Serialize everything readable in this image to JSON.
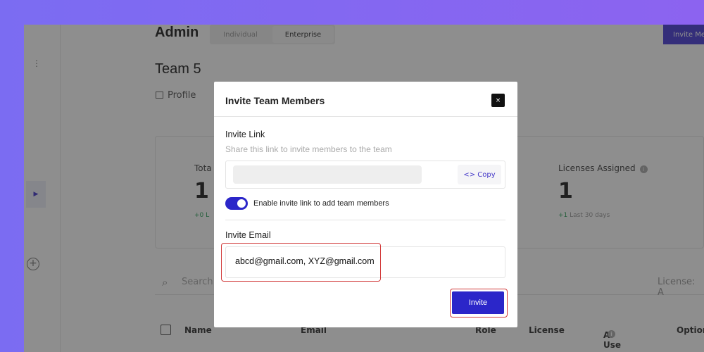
{
  "background_page": {
    "admin_title": "Admin",
    "segments": [
      "Individual",
      "Enterprise"
    ],
    "top_button": "Invite Me",
    "team_name": "Team 5",
    "tab_profile": "Profile",
    "stats": [
      {
        "label": "Tota",
        "value": "1",
        "delta": "+0 L"
      },
      {
        "label": "Licenses Assigned",
        "value": "1",
        "delta_value": "+1",
        "delta_text": "Last 30 days"
      }
    ],
    "search_placeholder": "Search",
    "license_filter": "License: A",
    "table_headers": [
      "Name",
      "Email",
      "Role",
      "License",
      "AI Use",
      "Option"
    ]
  },
  "modal": {
    "title": "Invite Team Members",
    "close_label": "×",
    "invite_link": {
      "label": "Invite Link",
      "subtitle": "Share this link to invite members to the team",
      "copy_label": "<> Copy"
    },
    "toggle_label": "Enable invite link to add team members",
    "toggle_on": true,
    "invite_email": {
      "label": "Invite Email",
      "value": "abcd@gmail.com, XYZ@gmail.com"
    },
    "invite_button": "Invite"
  },
  "colors": {
    "accent": "#2b26c9",
    "highlight": "#d23b3b",
    "background": "#8c63f0"
  }
}
